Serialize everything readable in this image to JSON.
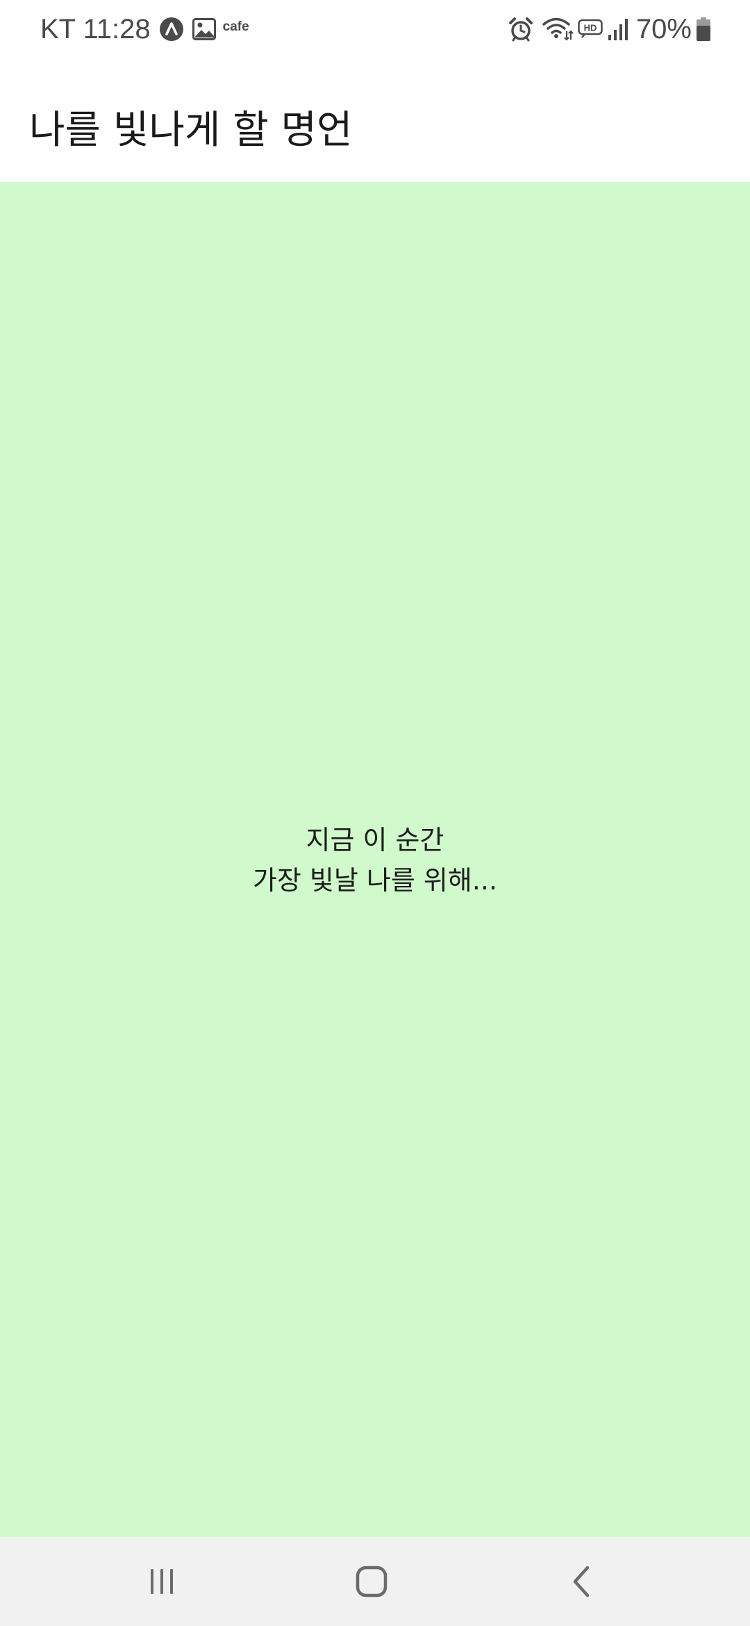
{
  "status_bar": {
    "carrier_time": "KT 11:28",
    "notification_label": "cafe",
    "battery_percent": "70%",
    "icons": [
      "app-a-icon",
      "image-icon",
      "alarm-icon",
      "wifi-icon",
      "hd-icon",
      "signal-icon",
      "battery-icon"
    ]
  },
  "app_bar": {
    "title": "나를 빛나게 할 명언"
  },
  "content": {
    "background_color": "#d0facb",
    "quote_line1": "지금 이 순간",
    "quote_line2": "가장 빛날 나를 위해..."
  },
  "nav_bar": {
    "buttons": [
      "recent-apps-icon",
      "home-icon",
      "back-icon"
    ]
  }
}
